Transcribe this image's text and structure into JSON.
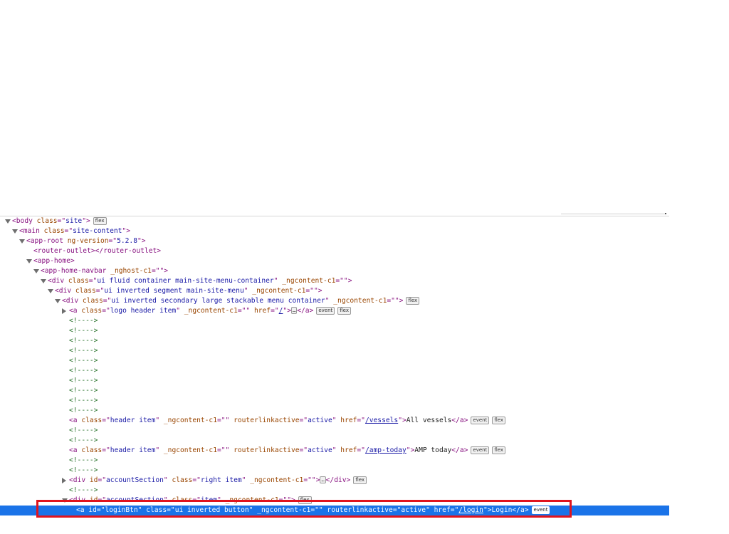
{
  "elements_panel": {
    "rows": [
      {
        "indent": 0,
        "tw": "open",
        "segments": [
          {
            "c": "tag",
            "t": "<body "
          },
          {
            "c": "an",
            "t": "class"
          },
          {
            "c": "tag",
            "t": "=\""
          },
          {
            "c": "av",
            "t": "site"
          },
          {
            "c": "tag",
            "t": "\">"
          }
        ],
        "badges": [
          "flex"
        ]
      },
      {
        "indent": 1,
        "tw": "open",
        "segments": [
          {
            "c": "tag",
            "t": "<main "
          },
          {
            "c": "an",
            "t": "class"
          },
          {
            "c": "tag",
            "t": "=\""
          },
          {
            "c": "av",
            "t": "site-content"
          },
          {
            "c": "tag",
            "t": "\">"
          }
        ]
      },
      {
        "indent": 2,
        "tw": "open",
        "segments": [
          {
            "c": "tag",
            "t": "<app-root "
          },
          {
            "c": "an",
            "t": "ng-version"
          },
          {
            "c": "tag",
            "t": "=\""
          },
          {
            "c": "av",
            "t": "5.2.8"
          },
          {
            "c": "tag",
            "t": "\">"
          }
        ]
      },
      {
        "indent": 3,
        "segments": [
          {
            "c": "tag",
            "t": "<router-outlet></router-outlet>"
          }
        ]
      },
      {
        "indent": 3,
        "tw": "open",
        "segments": [
          {
            "c": "tag",
            "t": "<app-home>"
          }
        ]
      },
      {
        "indent": 4,
        "tw": "open",
        "segments": [
          {
            "c": "tag",
            "t": "<app-home-navbar "
          },
          {
            "c": "an",
            "t": "_nghost-c1"
          },
          {
            "c": "tag",
            "t": "=\"\">"
          }
        ]
      },
      {
        "indent": 5,
        "tw": "open",
        "segments": [
          {
            "c": "tag",
            "t": "<div "
          },
          {
            "c": "an",
            "t": "class"
          },
          {
            "c": "tag",
            "t": "=\""
          },
          {
            "c": "av",
            "t": "ui fluid container main-site-menu-container"
          },
          {
            "c": "tag",
            "t": "\" "
          },
          {
            "c": "an",
            "t": "_ngcontent-c1"
          },
          {
            "c": "tag",
            "t": "=\"\">"
          }
        ]
      },
      {
        "indent": 6,
        "tw": "open",
        "segments": [
          {
            "c": "tag",
            "t": "<div "
          },
          {
            "c": "an",
            "t": "class"
          },
          {
            "c": "tag",
            "t": "=\""
          },
          {
            "c": "av",
            "t": "ui inverted segment main-site-menu"
          },
          {
            "c": "tag",
            "t": "\" "
          },
          {
            "c": "an",
            "t": "_ngcontent-c1"
          },
          {
            "c": "tag",
            "t": "=\"\">"
          }
        ]
      },
      {
        "indent": 7,
        "tw": "open",
        "segments": [
          {
            "c": "tag",
            "t": "<div "
          },
          {
            "c": "an",
            "t": "class"
          },
          {
            "c": "tag",
            "t": "=\""
          },
          {
            "c": "av",
            "t": "ui inverted secondary large stackable menu container"
          },
          {
            "c": "tag",
            "t": "\" "
          },
          {
            "c": "an",
            "t": "_ngcontent-c1"
          },
          {
            "c": "tag",
            "t": "=\"\">"
          }
        ],
        "badges": [
          "flex"
        ]
      },
      {
        "indent": 8,
        "tw": "closed",
        "segments": [
          {
            "c": "tag",
            "t": "<a "
          },
          {
            "c": "an",
            "t": "class"
          },
          {
            "c": "tag",
            "t": "=\""
          },
          {
            "c": "av",
            "t": "logo header item"
          },
          {
            "c": "tag",
            "t": "\" "
          },
          {
            "c": "an",
            "t": "_ngcontent-c1"
          },
          {
            "c": "tag",
            "t": "=\"\" "
          },
          {
            "c": "an",
            "t": "href"
          },
          {
            "c": "tag",
            "t": "=\""
          },
          {
            "c": "link",
            "t": "/"
          },
          {
            "c": "tag",
            "t": "\">"
          },
          {
            "c": "ell",
            "t": "…"
          },
          {
            "c": "tag",
            "t": "</a>"
          }
        ],
        "badges": [
          "event",
          "flex"
        ]
      },
      {
        "indent": 8,
        "segments": [
          {
            "c": "cm",
            "t": "<!---->"
          }
        ]
      },
      {
        "indent": 8,
        "segments": [
          {
            "c": "cm",
            "t": "<!---->"
          }
        ]
      },
      {
        "indent": 8,
        "segments": [
          {
            "c": "cm",
            "t": "<!---->"
          }
        ]
      },
      {
        "indent": 8,
        "segments": [
          {
            "c": "cm",
            "t": "<!---->"
          }
        ]
      },
      {
        "indent": 8,
        "segments": [
          {
            "c": "cm",
            "t": "<!---->"
          }
        ]
      },
      {
        "indent": 8,
        "segments": [
          {
            "c": "cm",
            "t": "<!---->"
          }
        ]
      },
      {
        "indent": 8,
        "segments": [
          {
            "c": "cm",
            "t": "<!---->"
          }
        ]
      },
      {
        "indent": 8,
        "segments": [
          {
            "c": "cm",
            "t": "<!---->"
          }
        ]
      },
      {
        "indent": 8,
        "segments": [
          {
            "c": "cm",
            "t": "<!---->"
          }
        ]
      },
      {
        "indent": 8,
        "segments": [
          {
            "c": "cm",
            "t": "<!---->"
          }
        ]
      },
      {
        "indent": 8,
        "segments": [
          {
            "c": "tag",
            "t": "<a "
          },
          {
            "c": "an",
            "t": "class"
          },
          {
            "c": "tag",
            "t": "=\""
          },
          {
            "c": "av",
            "t": "header item"
          },
          {
            "c": "tag",
            "t": "\" "
          },
          {
            "c": "an",
            "t": "_ngcontent-c1"
          },
          {
            "c": "tag",
            "t": "=\"\" "
          },
          {
            "c": "an",
            "t": "routerlinkactive"
          },
          {
            "c": "tag",
            "t": "=\""
          },
          {
            "c": "av",
            "t": "active"
          },
          {
            "c": "tag",
            "t": "\" "
          },
          {
            "c": "an",
            "t": "href"
          },
          {
            "c": "tag",
            "t": "=\""
          },
          {
            "c": "link",
            "t": "/vessels"
          },
          {
            "c": "tag",
            "t": "\">"
          },
          {
            "c": "txt",
            "t": "All vessels"
          },
          {
            "c": "tag",
            "t": "</a>"
          }
        ],
        "badges": [
          "event",
          "flex"
        ]
      },
      {
        "indent": 8,
        "segments": [
          {
            "c": "cm",
            "t": "<!---->"
          }
        ]
      },
      {
        "indent": 8,
        "segments": [
          {
            "c": "cm",
            "t": "<!---->"
          }
        ]
      },
      {
        "indent": 8,
        "segments": [
          {
            "c": "tag",
            "t": "<a "
          },
          {
            "c": "an",
            "t": "class"
          },
          {
            "c": "tag",
            "t": "=\""
          },
          {
            "c": "av",
            "t": "header item"
          },
          {
            "c": "tag",
            "t": "\" "
          },
          {
            "c": "an",
            "t": "_ngcontent-c1"
          },
          {
            "c": "tag",
            "t": "=\"\" "
          },
          {
            "c": "an",
            "t": "routerlinkactive"
          },
          {
            "c": "tag",
            "t": "=\""
          },
          {
            "c": "av",
            "t": "active"
          },
          {
            "c": "tag",
            "t": "\" "
          },
          {
            "c": "an",
            "t": "href"
          },
          {
            "c": "tag",
            "t": "=\""
          },
          {
            "c": "link",
            "t": "/amp-today"
          },
          {
            "c": "tag",
            "t": "\">"
          },
          {
            "c": "txt",
            "t": "AMP today"
          },
          {
            "c": "tag",
            "t": "</a>"
          }
        ],
        "badges": [
          "event",
          "flex"
        ]
      },
      {
        "indent": 8,
        "segments": [
          {
            "c": "cm",
            "t": "<!---->"
          }
        ]
      },
      {
        "indent": 8,
        "segments": [
          {
            "c": "cm",
            "t": "<!---->"
          }
        ]
      },
      {
        "indent": 8,
        "tw": "closed",
        "segments": [
          {
            "c": "tag",
            "t": "<div "
          },
          {
            "c": "an",
            "t": "id"
          },
          {
            "c": "tag",
            "t": "=\""
          },
          {
            "c": "av",
            "t": "accountSection"
          },
          {
            "c": "tag",
            "t": "\" "
          },
          {
            "c": "an",
            "t": "class"
          },
          {
            "c": "tag",
            "t": "=\""
          },
          {
            "c": "av",
            "t": "right item"
          },
          {
            "c": "tag",
            "t": "\" "
          },
          {
            "c": "an",
            "t": "_ngcontent-c1"
          },
          {
            "c": "tag",
            "t": "=\"\">"
          },
          {
            "c": "ell",
            "t": "…"
          },
          {
            "c": "tag",
            "t": "</div>"
          }
        ],
        "badges": [
          "flex"
        ]
      },
      {
        "indent": 8,
        "segments": [
          {
            "c": "cm",
            "t": "<!---->"
          }
        ]
      },
      {
        "indent": 8,
        "tw": "open",
        "segments": [
          {
            "c": "tag",
            "t": "<div "
          },
          {
            "c": "an",
            "t": "id"
          },
          {
            "c": "tag",
            "t": "=\""
          },
          {
            "c": "av",
            "t": "accountSection"
          },
          {
            "c": "tag",
            "t": "\" "
          },
          {
            "c": "an",
            "t": "class"
          },
          {
            "c": "tag",
            "t": "=\""
          },
          {
            "c": "av",
            "t": "item"
          },
          {
            "c": "tag",
            "t": "\" "
          },
          {
            "c": "an",
            "t": "_ngcontent-c1"
          },
          {
            "c": "tag",
            "t": "=\"\">"
          }
        ],
        "badges": [
          "flex"
        ]
      },
      {
        "indent": 9,
        "selected": true,
        "segments": [
          {
            "c": "tag",
            "t": "<a "
          },
          {
            "c": "an",
            "t": "id"
          },
          {
            "c": "tag",
            "t": "=\""
          },
          {
            "c": "av",
            "t": "loginBtn"
          },
          {
            "c": "tag",
            "t": "\" "
          },
          {
            "c": "an",
            "t": "class"
          },
          {
            "c": "tag",
            "t": "=\""
          },
          {
            "c": "av",
            "t": "ui inverted button"
          },
          {
            "c": "tag",
            "t": "\" "
          },
          {
            "c": "an",
            "t": "_ngcontent-c1"
          },
          {
            "c": "tag",
            "t": "=\"\" "
          },
          {
            "c": "an",
            "t": "routerlinkactive"
          },
          {
            "c": "tag",
            "t": "=\""
          },
          {
            "c": "av",
            "t": "active"
          },
          {
            "c": "tag",
            "t": "\" "
          },
          {
            "c": "an",
            "t": "href"
          },
          {
            "c": "tag",
            "t": "=\""
          },
          {
            "c": "link",
            "t": "/login"
          },
          {
            "c": "tag",
            "t": "\">"
          },
          {
            "c": "txt",
            "t": "Login"
          },
          {
            "c": "tag",
            "t": "</a>"
          }
        ],
        "badges": [
          "event"
        ]
      }
    ]
  },
  "colors": {
    "tag": "#881280",
    "attribute_name": "#994500",
    "attribute_value": "#1a1aa6",
    "comment": "#236e25",
    "selection": "#1a73e8",
    "annotation_box": "#e0141e"
  }
}
